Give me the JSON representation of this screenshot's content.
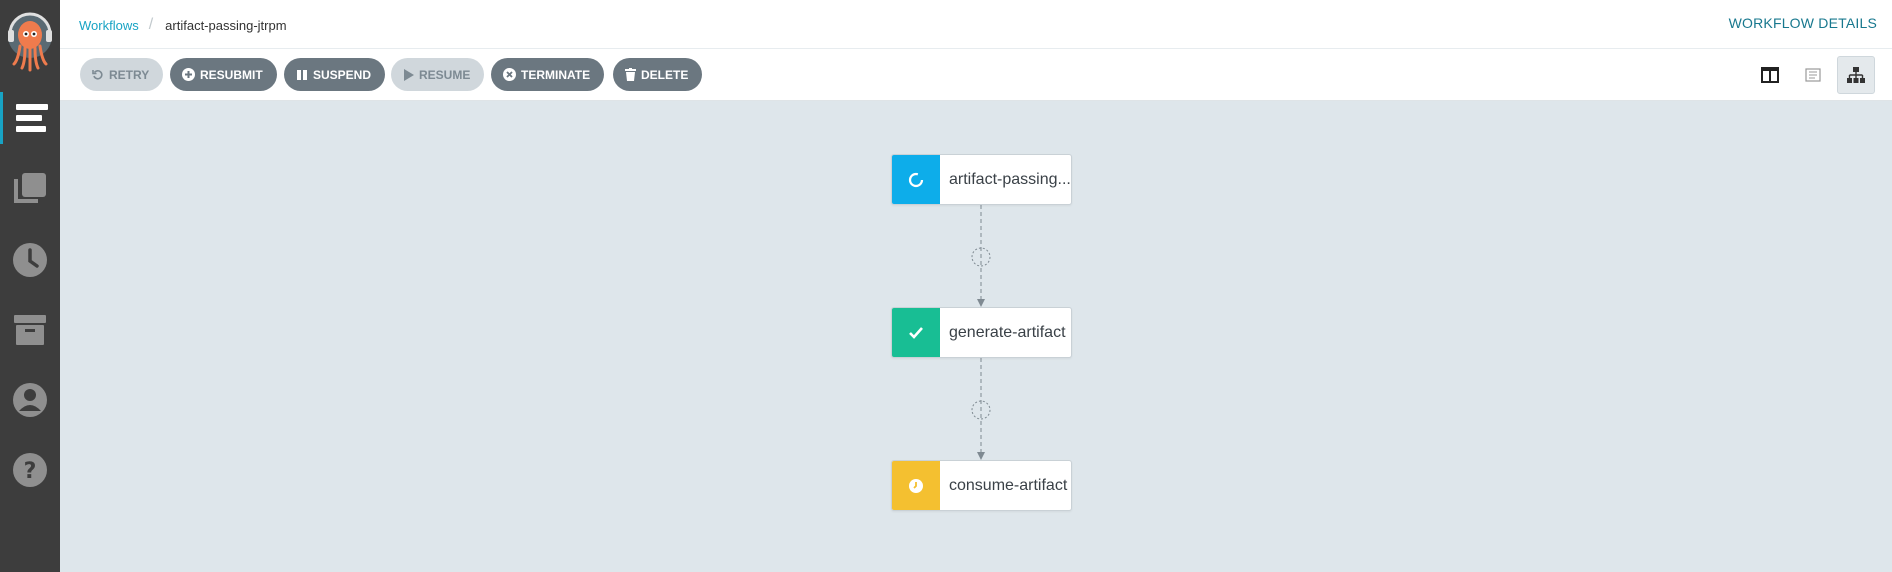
{
  "sidebar": {
    "logo": "argo-logo",
    "items": [
      {
        "icon": "workflows-icon",
        "active": true
      },
      {
        "icon": "workflow-templates-icon",
        "active": false
      },
      {
        "icon": "cron-workflows-icon",
        "active": false
      },
      {
        "icon": "archived-workflows-icon",
        "active": false
      },
      {
        "icon": "user-icon",
        "active": false
      },
      {
        "icon": "help-icon",
        "active": false
      }
    ]
  },
  "header": {
    "breadcrumb": {
      "root": "Workflows",
      "current": "artifact-passing-jtrpm"
    },
    "title": "WORKFLOW DETAILS"
  },
  "toolbar": {
    "retry": "RETRY",
    "resubmit": "RESUBMIT",
    "suspend": "SUSPEND",
    "resume": "RESUME",
    "terminate": "TERMINATE",
    "delete": "DELETE",
    "view_modes": [
      "split-view-icon",
      "list-view-icon",
      "graph-view-icon"
    ],
    "active_view": "graph-view-icon"
  },
  "graph": {
    "nodes": [
      {
        "label": "artifact-passing...",
        "status": "running",
        "color": "#0dadea"
      },
      {
        "label": "generate-artifact",
        "status": "succeeded",
        "color": "#18be94"
      },
      {
        "label": "consume-artifact",
        "status": "pending",
        "color": "#f4c030"
      }
    ]
  },
  "colors": {
    "accent": "#18a3c4",
    "sidebar_bg": "#3d3d3d",
    "canvas_bg": "#dee6eb",
    "button_bg": "#6b7780"
  }
}
